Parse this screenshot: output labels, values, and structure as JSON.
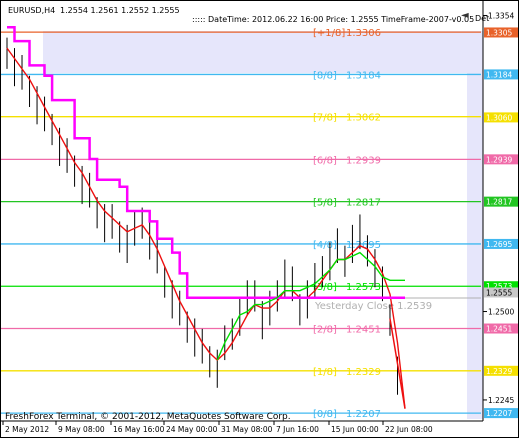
{
  "header": {
    "symbol": "EURUSD,H4",
    "ohlc": "1.2554 1.2561 1.2552 1.2555",
    "info": "::::: DateTime: 2012.06.22 16:00     Price: 1.2555     TimeFrame-2007-v0.05",
    "collapse_glyph": "◄",
    "det_label": "Det"
  },
  "footer": {
    "copyright": "FreshForex Terminal, © 2001-2012, MetaQuotes Software Corp."
  },
  "murrey_levels": [
    {
      "label": "[+1/8]",
      "value": "1.3306",
      "color": "#e8622a"
    },
    {
      "label": "[8/8]",
      "value": "1.3184",
      "color": "#40b8f0"
    },
    {
      "label": "[7/8]",
      "value": "1.3062",
      "color": "#f5e000"
    },
    {
      "label": "[6/8]",
      "value": "1.2939",
      "color": "#f06aa8"
    },
    {
      "label": "[5/8]",
      "value": "1.2817",
      "color": "#22c522"
    },
    {
      "label": "[4/8]",
      "value": "1.2695",
      "color": "#40b8f0"
    },
    {
      "label": "[3/8]",
      "value": "1.2573",
      "color": "#00e000"
    },
    {
      "label": "[2/8]",
      "value": "1.2451",
      "color": "#f06aa8"
    },
    {
      "label": "[1/8]",
      "value": "1.2329",
      "color": "#f5e000"
    },
    {
      "label": "[0/8]",
      "value": "1.2207",
      "color": "#40b8f0"
    }
  ],
  "yesterday_close": {
    "label": "Yesterday Close",
    "value": "1.2539"
  },
  "price_axis": {
    "ticks": [
      "1.3354",
      "1.3305",
      "1.3184",
      "1.3060",
      "1.2939",
      "1.2817",
      "1.2695",
      "1.2573",
      "1.2500",
      "1.2451",
      "1.2329",
      "1.2245",
      "1.2207"
    ],
    "current_price": "1.2555",
    "range": [
      1.219,
      1.339
    ]
  },
  "time_axis": {
    "ticks": [
      "2 May 2012",
      "9 May 08:00",
      "16 May 16:00",
      "24 May 00:00",
      "31 May 08:00",
      "7 Jun 16:00",
      "15 Jun 00:00",
      "22 Jun 08:00"
    ]
  },
  "chart_data": {
    "type": "line",
    "title": "",
    "series": [
      {
        "color": "#000000",
        "values": [
          1.325,
          1.321,
          1.318,
          1.314,
          1.31,
          1.306,
          1.303,
          1.298,
          1.294,
          1.291,
          1.287,
          1.284,
          1.279,
          1.276,
          1.275,
          1.272,
          1.27,
          1.273,
          1.276,
          1.271,
          1.265,
          1.259,
          1.254,
          1.25,
          1.246,
          1.243,
          1.239,
          1.236,
          1.234,
          1.24,
          1.244,
          1.249,
          1.253,
          1.255,
          1.248,
          1.25,
          1.255,
          1.26,
          1.257,
          1.251,
          1.254,
          1.258,
          1.262,
          1.265,
          1.268,
          1.265,
          1.27,
          1.272,
          1.268,
          1.263,
          1.257,
          1.248,
          1.232,
          1.222
        ]
      },
      {
        "color": "#ee1010",
        "values": [
          1.326,
          1.323,
          1.32,
          1.317,
          1.313,
          1.309,
          1.305,
          1.301,
          1.297,
          1.293,
          1.29,
          1.286,
          1.282,
          1.279,
          1.277,
          1.275,
          1.273,
          1.274,
          1.275,
          1.272,
          1.268,
          1.263,
          1.258,
          1.253,
          1.249,
          1.245,
          1.241,
          1.238,
          1.236,
          1.238,
          1.241,
          1.245,
          1.249,
          1.252,
          1.251,
          1.251,
          1.253,
          1.256,
          1.256,
          1.254,
          1.254,
          1.256,
          1.259,
          1.262,
          1.265,
          1.265,
          1.267,
          1.269,
          1.268,
          1.265,
          1.261,
          1.255,
          1.241,
          1.222
        ]
      },
      {
        "color": "#ff00ff",
        "values": [
          1.332,
          1.328,
          1.328,
          1.321,
          1.321,
          1.318,
          1.311,
          1.311,
          1.311,
          1.3,
          1.3,
          1.294,
          1.288,
          1.288,
          1.288,
          1.286,
          1.279,
          1.279,
          1.279,
          1.276,
          1.271,
          1.271,
          1.267,
          1.261,
          1.254,
          1.254,
          1.254,
          1.254,
          1.254,
          1.254,
          1.254,
          1.254,
          1.254,
          1.254,
          1.254,
          1.254,
          1.254,
          1.254,
          1.254,
          1.254,
          1.254,
          1.254,
          1.254,
          1.254,
          1.254,
          1.254,
          1.254,
          1.254,
          1.254,
          1.254,
          1.254,
          1.254,
          1.254,
          1.254
        ]
      },
      {
        "color": "#00e000",
        "values": [
          null,
          null,
          null,
          null,
          null,
          null,
          null,
          null,
          null,
          null,
          null,
          null,
          null,
          null,
          null,
          null,
          null,
          null,
          null,
          null,
          null,
          null,
          null,
          null,
          null,
          null,
          null,
          null,
          1.236,
          1.241,
          1.245,
          1.249,
          1.25,
          1.252,
          1.252,
          1.253,
          1.254,
          1.256,
          1.256,
          1.256,
          1.257,
          1.258,
          1.26,
          1.262,
          1.265,
          1.265,
          1.266,
          1.267,
          1.265,
          1.263,
          1.26,
          1.259,
          1.259,
          1.259
        ]
      }
    ],
    "xlim": [
      0,
      53
    ],
    "ylim": [
      1.219,
      1.339
    ]
  }
}
